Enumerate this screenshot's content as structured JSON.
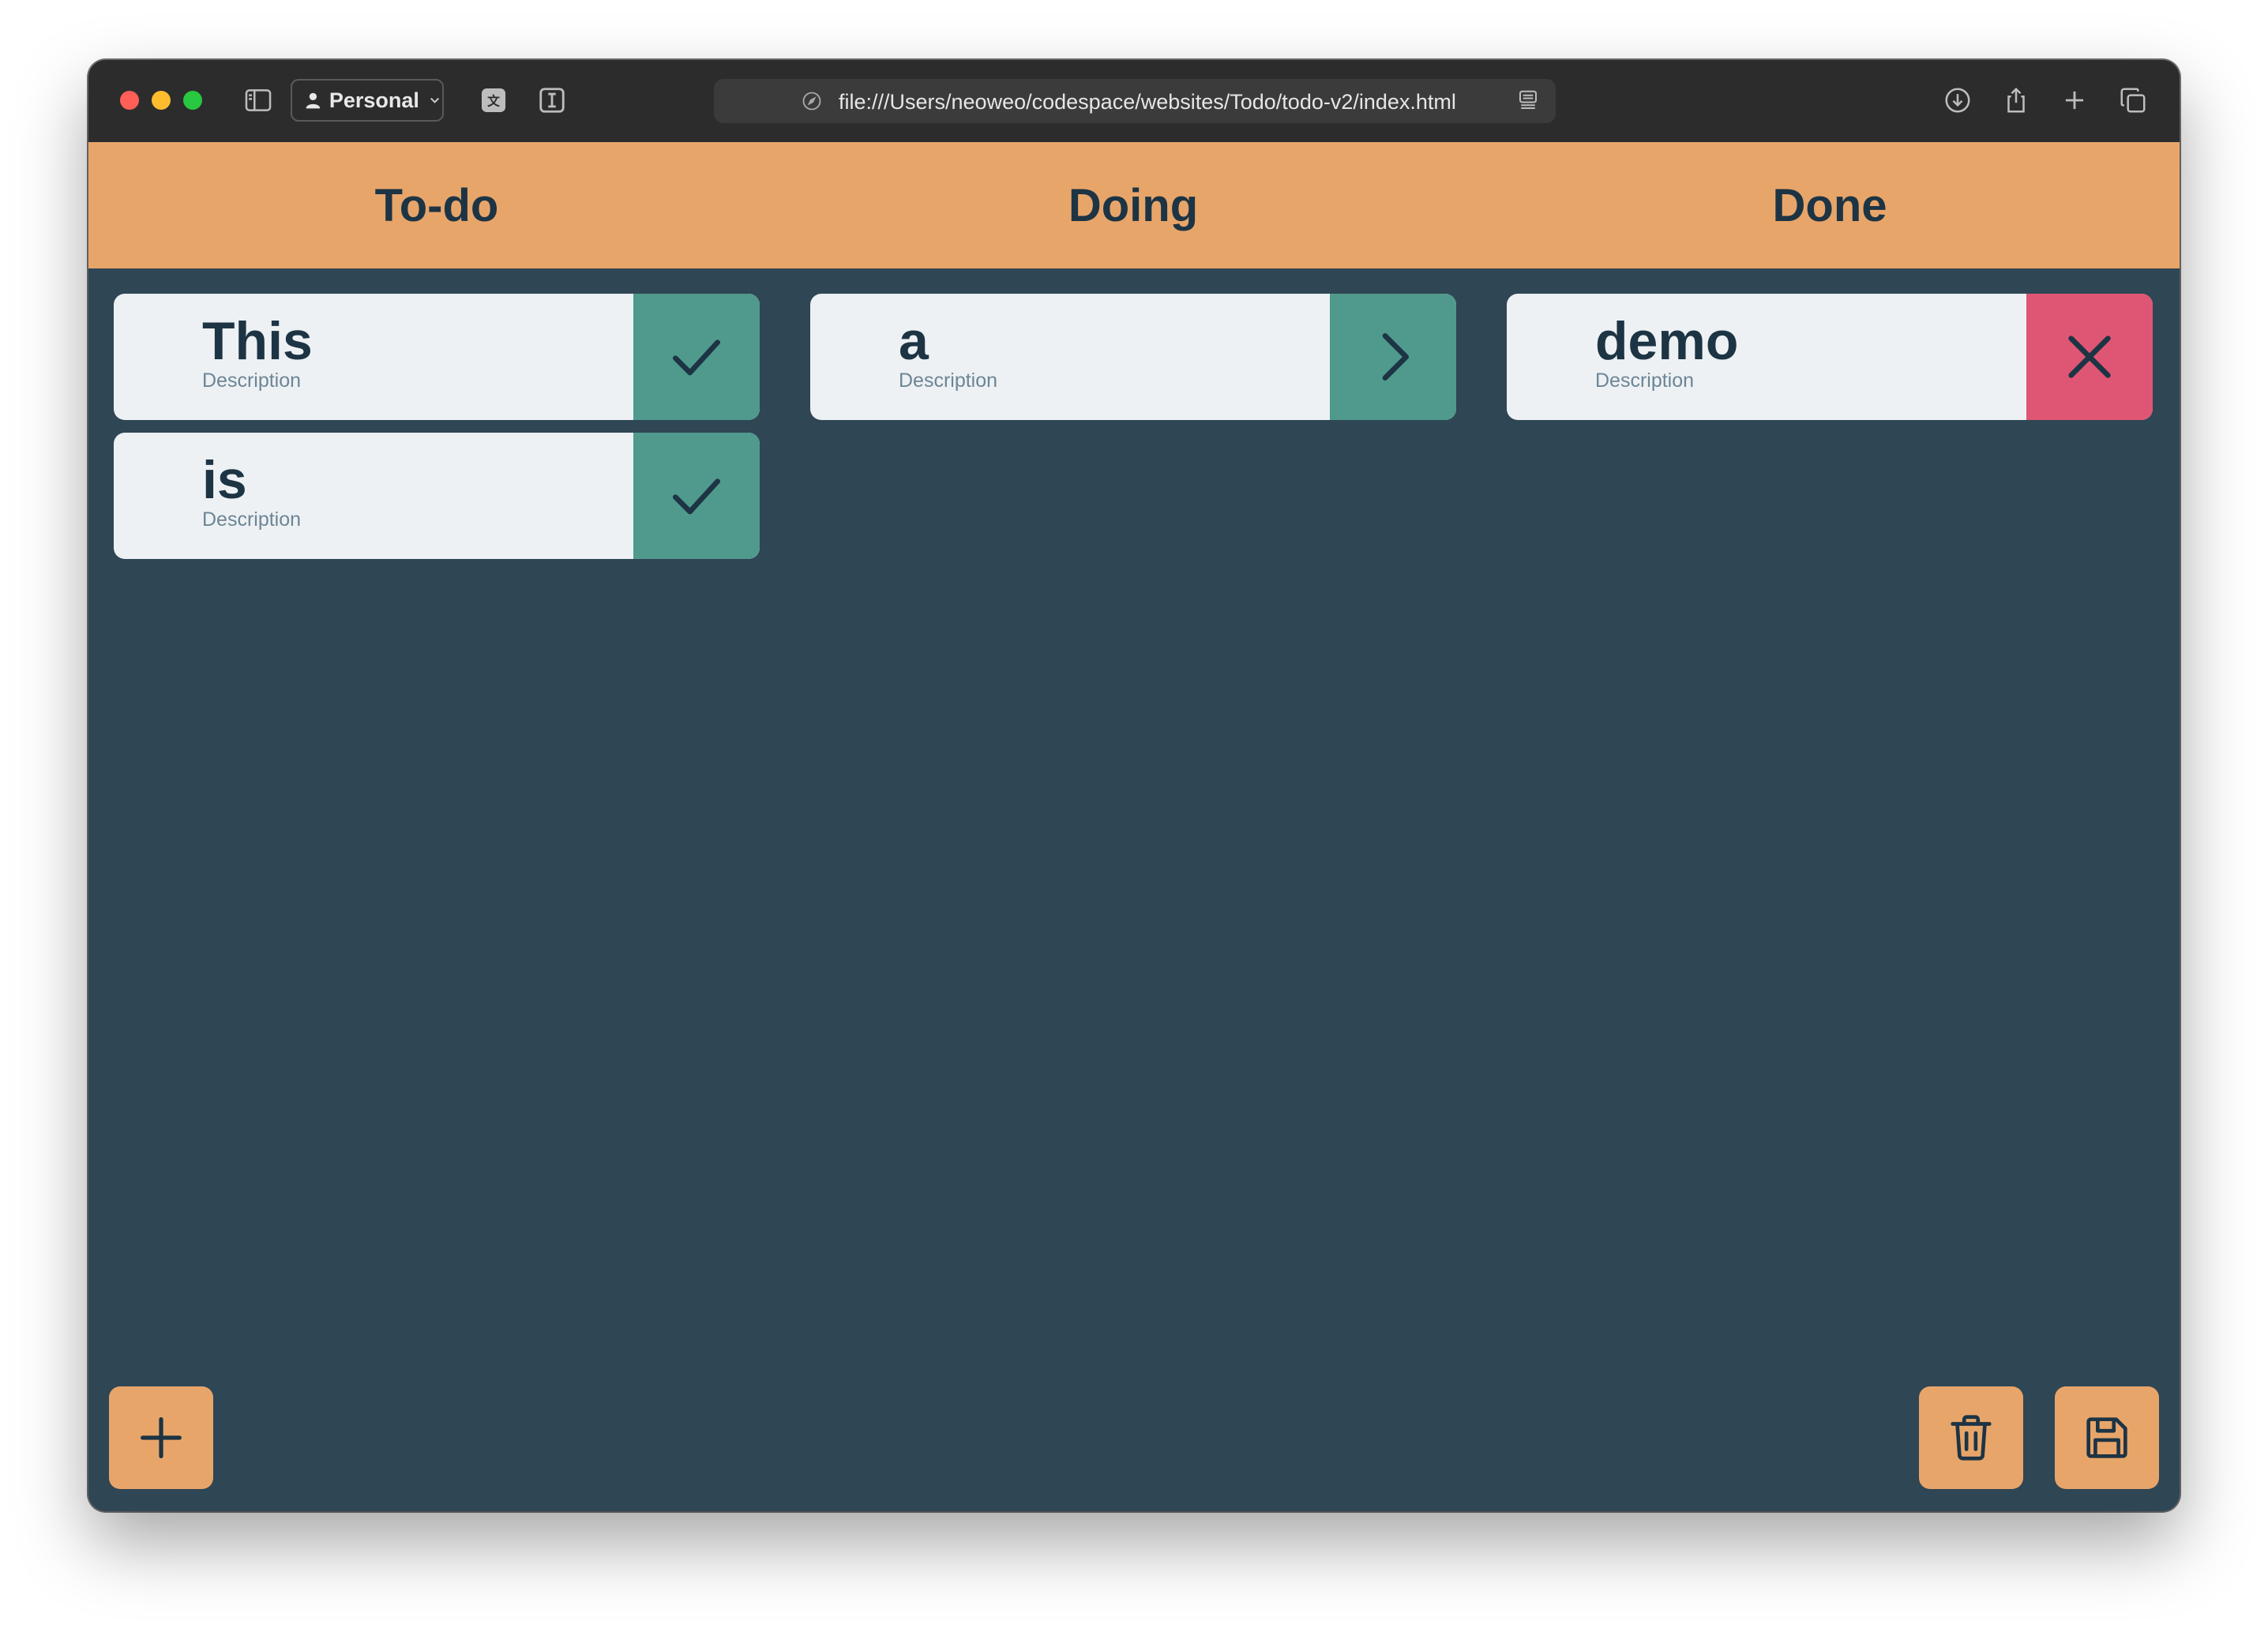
{
  "browser": {
    "profile_label": "Personal",
    "url": "file:///Users/neoweo/codespace/websites/Todo/todo-v2/index.html"
  },
  "board": {
    "columns": [
      {
        "title": "To-do",
        "cards": [
          {
            "title": "This",
            "description": "Description",
            "action_icon": "check-icon"
          },
          {
            "title": "is",
            "description": "Description",
            "action_icon": "check-icon"
          }
        ]
      },
      {
        "title": "Doing",
        "cards": [
          {
            "title": "a",
            "description": "Description",
            "action_icon": "chevron-right-icon"
          }
        ]
      },
      {
        "title": "Done",
        "cards": [
          {
            "title": "demo",
            "description": "Description",
            "action_icon": "close-icon"
          }
        ]
      }
    ]
  },
  "footer_actions": {
    "add_icon": "plus-icon",
    "delete_icon": "trash-icon",
    "save_icon": "save-icon"
  },
  "colors": {
    "header_bg": "#e8a56a",
    "board_bg": "#2f4654",
    "card_bg": "#edf1f4",
    "text_dark": "#1d3444",
    "action_green": "#4f9a8d",
    "action_red": "#df5674"
  }
}
